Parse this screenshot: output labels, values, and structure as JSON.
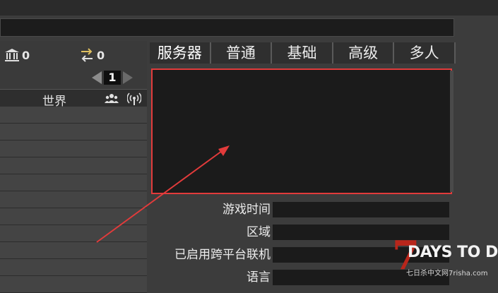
{
  "header": {
    "search_value": ""
  },
  "stats": {
    "bank_count": "0",
    "transfer_count": "0"
  },
  "pager": {
    "page": "1"
  },
  "server_list": {
    "column_world": "世界",
    "rows": [
      "",
      "",
      "",
      "",
      "",
      "",
      "",
      "",
      "",
      "",
      ""
    ]
  },
  "tabs": [
    {
      "label": "服务器"
    },
    {
      "label": "普通"
    },
    {
      "label": "基础"
    },
    {
      "label": "高级"
    },
    {
      "label": "多人"
    }
  ],
  "details": {
    "fields": [
      {
        "label": "游戏时间",
        "value": ""
      },
      {
        "label": "区域",
        "value": ""
      },
      {
        "label": "已启用跨平台联机",
        "value": ""
      },
      {
        "label": "语言",
        "value": ""
      }
    ]
  },
  "watermark": {
    "seven": "7",
    "title": "DAYS TO DIE",
    "subtitle": "七日杀中文网7risha.com"
  },
  "colors": {
    "highlight": "#e23b3b",
    "logo_red": "#b8261b"
  }
}
